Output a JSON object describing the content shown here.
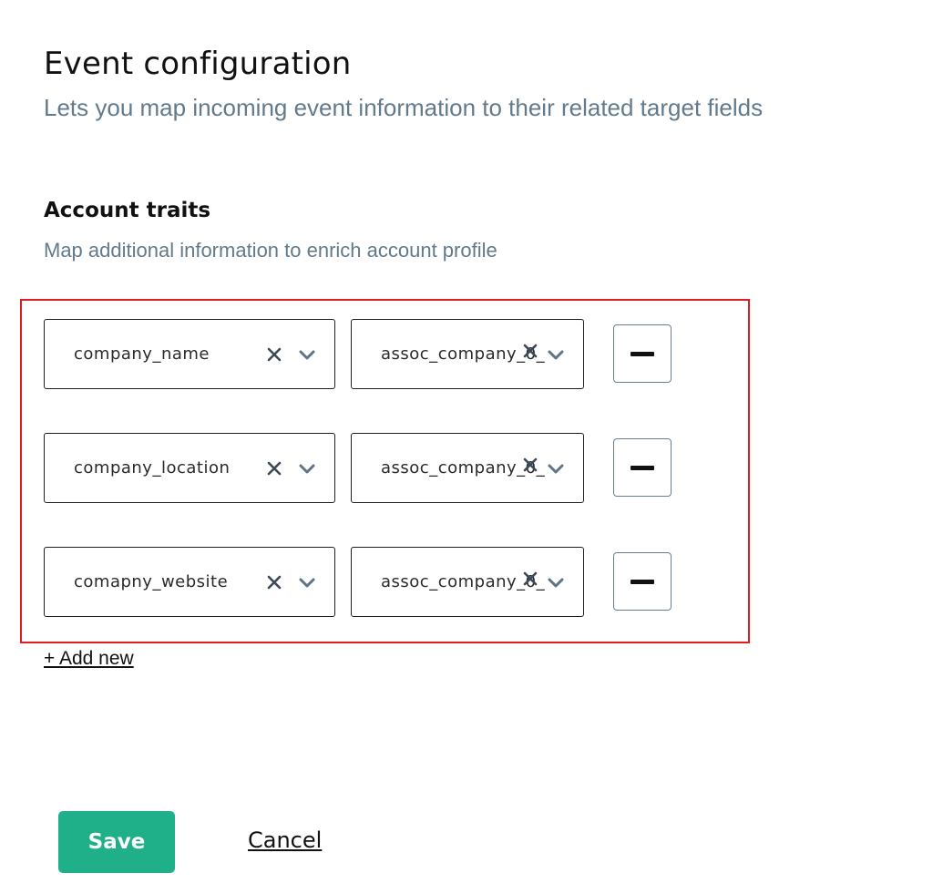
{
  "header": {
    "title": "Event configuration",
    "subtitle": "Lets you map incoming event information to their related target fields"
  },
  "section": {
    "title": "Account traits",
    "subtitle": "Map additional information to enrich account profile"
  },
  "mappings": [
    {
      "source": "company_name",
      "target": "assoc_company_0_"
    },
    {
      "source": "company_location",
      "target": "assoc_company_0_"
    },
    {
      "source": "comapny_website",
      "target": "assoc_company_0_"
    }
  ],
  "actions": {
    "add_new_label": "+ Add new",
    "save_label": "Save",
    "cancel_label": "Cancel"
  },
  "icons": {
    "clear": "close-icon",
    "dropdown": "chevron-down-icon",
    "remove": "minus-icon"
  },
  "colors": {
    "accent": "#1fb08a",
    "subtitle_text": "#627a8c",
    "highlight_border": "#e11d24",
    "icon_gray": "#5f7488"
  }
}
